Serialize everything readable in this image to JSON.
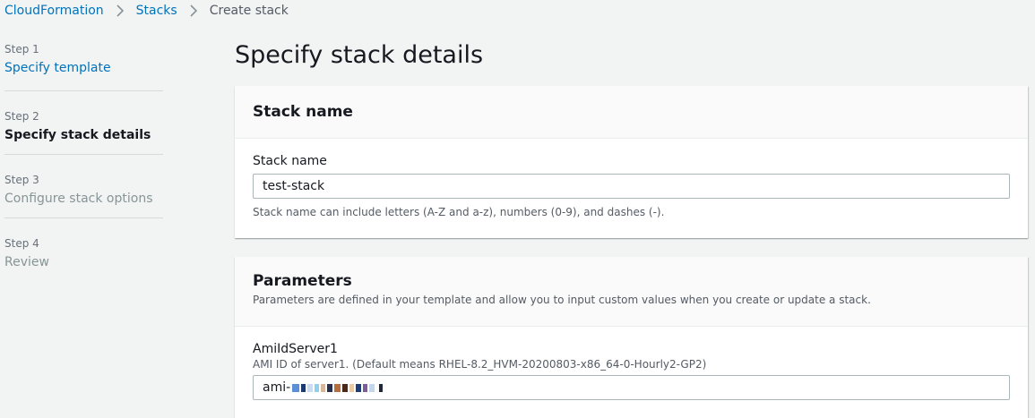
{
  "breadcrumb": {
    "items": [
      "CloudFormation",
      "Stacks"
    ],
    "current": "Create stack"
  },
  "wizard": {
    "steps": [
      {
        "num": "Step 1",
        "title": "Specify template"
      },
      {
        "num": "Step 2",
        "title": "Specify stack details"
      },
      {
        "num": "Step 3",
        "title": "Configure stack options"
      },
      {
        "num": "Step 4",
        "title": "Review"
      }
    ]
  },
  "page": {
    "title": "Specify stack details"
  },
  "stack_name_panel": {
    "header": "Stack name",
    "field_label": "Stack name",
    "field_value": "test-stack",
    "constraint": "Stack name can include letters (A-Z and a-z), numbers (0-9), and dashes (-)."
  },
  "parameters_panel": {
    "header": "Parameters",
    "description": "Parameters are defined in your template and allow you to input custom values when you create or update a stack.",
    "param_name": "AmiIdServer1",
    "param_desc": "AMI ID of server1. (Default means RHEL-8.2_HVM-20200803-x86_64-0-Hourly2-GP2)",
    "param_value_prefix": "ami-"
  },
  "colors": {
    "link": "#0073bb",
    "background": "#f2f3f3",
    "panel_header": "#fafafa",
    "text": "#16191f",
    "muted": "#545b64",
    "disabled": "#879596"
  }
}
